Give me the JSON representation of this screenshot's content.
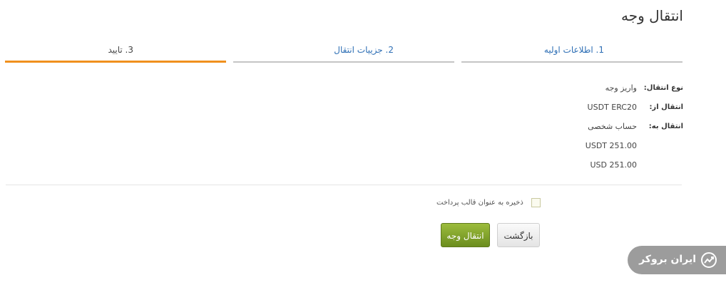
{
  "page": {
    "title": "انتقال وجه"
  },
  "steps": [
    {
      "label": "1. اطلاعات اولیه",
      "state": "done"
    },
    {
      "label": "2. جزییات انتقال",
      "state": "done"
    },
    {
      "label": "3. تایید",
      "state": "active"
    }
  ],
  "details": {
    "type_label": "نوع انتقال:",
    "type_value": "واریز وجه",
    "from_label": "انتقال از:",
    "from_value": "USDT ERC20",
    "to_label": "انتقال به:",
    "to_value": "حساب شخصی",
    "amount_crypto": "USDT 251.00",
    "amount_fiat": "USD 251.00"
  },
  "save_template": {
    "label": "ذخیره به عنوان قالب پرداخت",
    "checked": false
  },
  "buttons": {
    "back": "بازگشت",
    "transfer": "انتقال وجه"
  },
  "watermark": {
    "text": "ایران بروکر"
  },
  "colors": {
    "active_step": "#f0901e",
    "link": "#2e6fb5",
    "primary_button": "#7a9a26"
  }
}
